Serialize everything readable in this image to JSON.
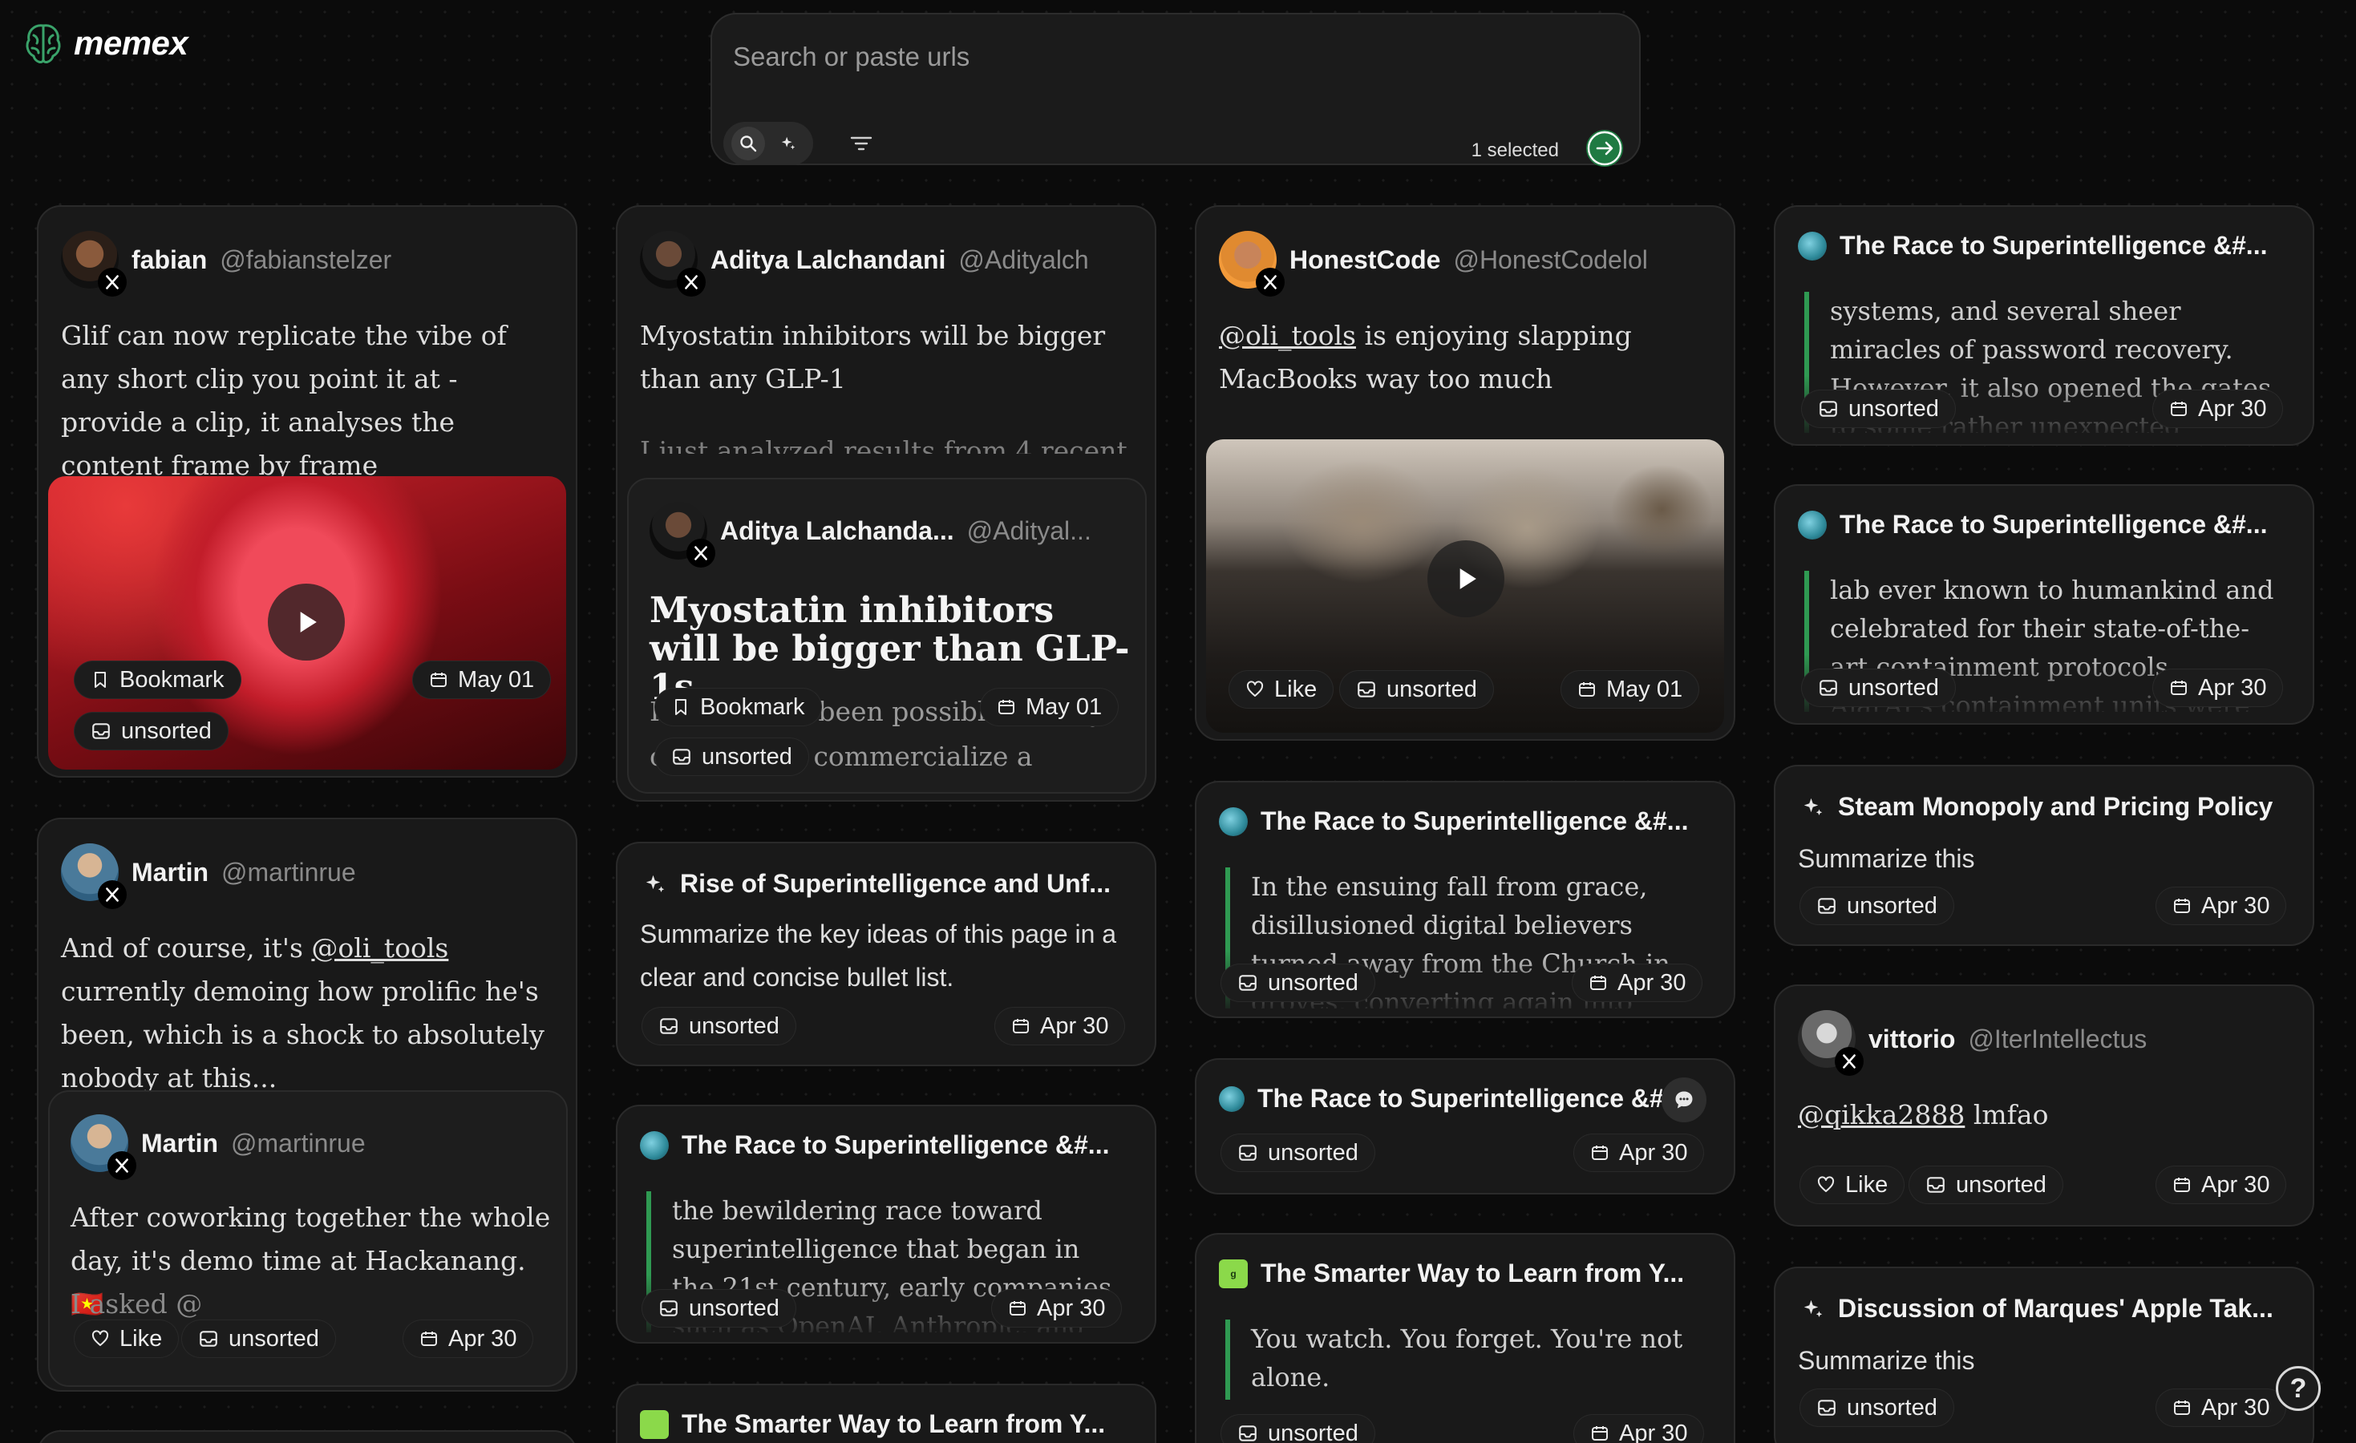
{
  "app": {
    "name": "memex"
  },
  "search": {
    "placeholder": "Search or paste urls",
    "selected_text": "1 selected"
  },
  "labels": {
    "bookmark": "Bookmark",
    "unsorted": "unsorted",
    "like": "Like",
    "summarize": "Summarize this"
  },
  "cards": {
    "fabian": {
      "author": "fabian",
      "handle": "@fabianstelzer",
      "text": "Glif can now replicate the vibe of any short clip you point it at - provide a clip, it analyses the content frame by frame",
      "date": "May 01"
    },
    "aditya": {
      "author": "Aditya Lalchandani",
      "handle": "@Adityalch",
      "text": "Myostatin inhibitors will be bigger than any GLP-1",
      "text_faded": "I just analyzed results from 4 recent",
      "quoted": {
        "author": "Aditya Lalchanda...",
        "handle": "@Adityal...",
        "headline": "Myostatin inhibitors will be bigger than GLP-1s",
        "text": "It has never been possible for any company to commercialize a"
      },
      "date": "May 01"
    },
    "honestcode": {
      "author": "HonestCode",
      "handle": "@HonestCodelol",
      "mention": "@oli_tools",
      "text": " is enjoying slapping MacBooks way too much",
      "date": "May 01"
    },
    "race1": {
      "title": "The Race to Superintelligence &#...",
      "excerpt": "systems, and several sheer miracles of password recovery. However, it also opened the gates to some rather unexpected consequences. To",
      "date": "Apr 30"
    },
    "race2": {
      "title": "The Race to Superintelligence &#...",
      "excerpt": "lab ever known to humankind and celebrated for their state-of-the-art containment protocols. AjarAI's containment units were so",
      "date": "Apr 30"
    },
    "steam": {
      "title": "Steam Monopoly and Pricing Policy",
      "date": "Apr 30"
    },
    "martin": {
      "author": "Martin",
      "handle": "@martinrue",
      "text_before": "And of course, it's ",
      "mention": "@oli_tools",
      "text_after": " currently demoing how prolific he's been, which is a shock to absolutely nobody at this...",
      "quoted": {
        "author": "Martin",
        "handle": "@martinrue",
        "text": "After coworking together the whole day, it's demo time at Hackanang. 🇻🇳",
        "text_faded": "I asked @"
      },
      "date": "Apr 30"
    },
    "rise": {
      "title": "Rise of Superintelligence and Unf...",
      "text": "Summarize the key ideas of this page in a clear and concise bullet list.",
      "date": "Apr 30"
    },
    "race3": {
      "title": "The Race to Superintelligence &#...",
      "excerpt": "In the ensuing fall from grace, disillusioned digital believers turned away from the Church in droves, converting again into devout",
      "date": "Apr 30"
    },
    "vittorio": {
      "author": "vittorio",
      "handle": "@IterIntellectus",
      "mention": "@qikka2888",
      "text": " lmfao",
      "date": "Apr 30"
    },
    "race4": {
      "title": "The Race to Superintelligence &#...",
      "excerpt": "the bewildering race toward superintelligence that began in the 21st century, early companies such as OpenAI, Anthropic, and DeepMind",
      "date": "Apr 30"
    },
    "race5": {
      "title": "The Race to Superintelligence &#...",
      "date": "Apr 30"
    },
    "smarter1": {
      "title": "The Smarter Way to Learn from Y...",
      "text": "You watch. You forget. You're not alone.",
      "date": "Apr 30"
    },
    "marques": {
      "title": "Discussion of Marques' Apple Tak...",
      "date": "Apr 30"
    },
    "smarter2": {
      "title": "The Smarter Way to Learn from Y..."
    }
  },
  "colors": {
    "accent_green": "#1f7a42",
    "quote_bar": "#2f9a52",
    "background": "#0b0b0b",
    "card": "#191919"
  },
  "help": {
    "label": "?"
  }
}
